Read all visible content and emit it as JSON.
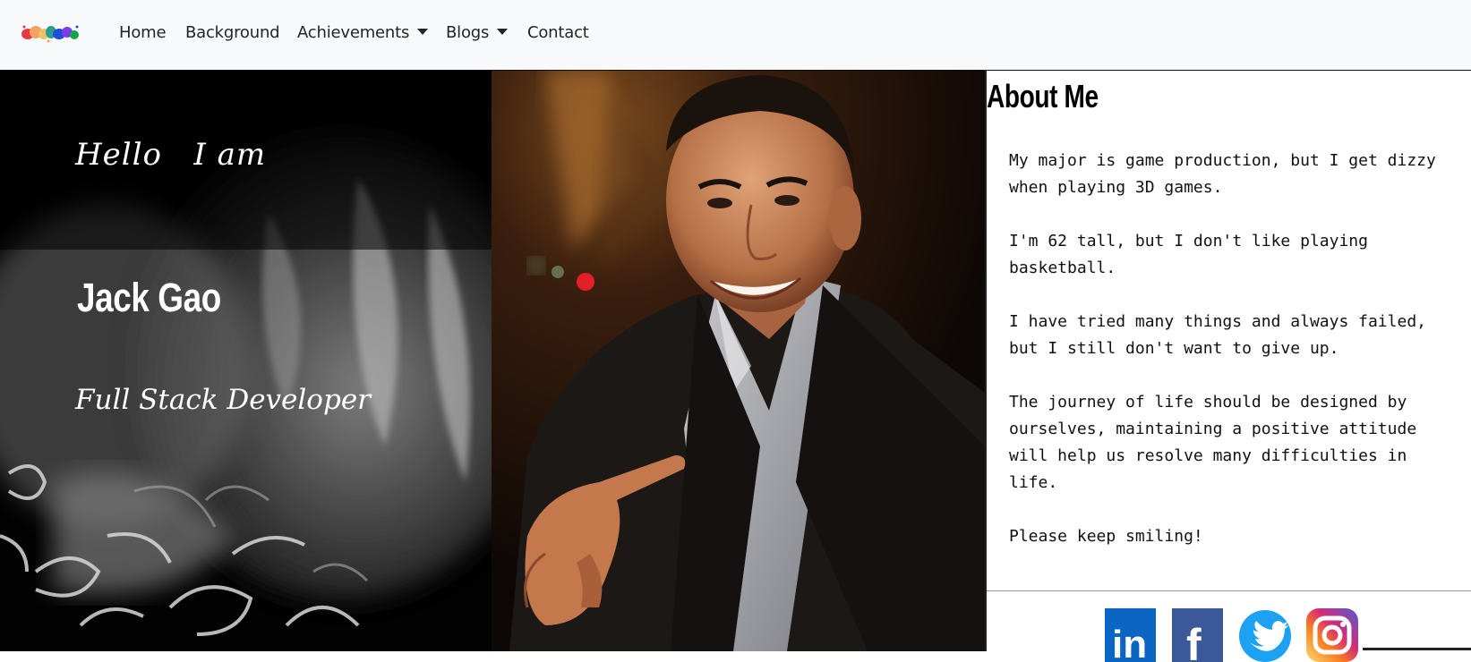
{
  "nav": {
    "logo_alt": "colorful splash logo",
    "links": [
      {
        "label": "Home"
      },
      {
        "label": "Background"
      },
      {
        "label": "Achievements",
        "dropdown": true
      },
      {
        "label": "Blogs",
        "dropdown": true
      },
      {
        "label": "Contact"
      }
    ]
  },
  "hero": {
    "greeting": "Hello   I am",
    "name": "Jack Gao",
    "role": "Full Stack Developer"
  },
  "about": {
    "title": "About Me",
    "paragraphs": [
      "My major is game production, but I get dizzy when playing 3D games.",
      "I'm 62 tall, but I don't like playing basketball.",
      "I have tried many things and always failed, but I still don't want to give up.",
      "The journey of life should be designed by ourselves, maintaining a positive attitude will help us resolve many difficulties in life.",
      "Please keep smiling!"
    ]
  },
  "social": {
    "items": [
      {
        "icon": "linkedin-icon",
        "glyph": "in",
        "color": "#0a66c2"
      },
      {
        "icon": "facebook-icon",
        "glyph": "f",
        "color": "#3b5998"
      },
      {
        "icon": "twitter-icon",
        "color": "#1da1f2"
      },
      {
        "icon": "instagram-icon",
        "color": "#c13584"
      }
    ]
  }
}
